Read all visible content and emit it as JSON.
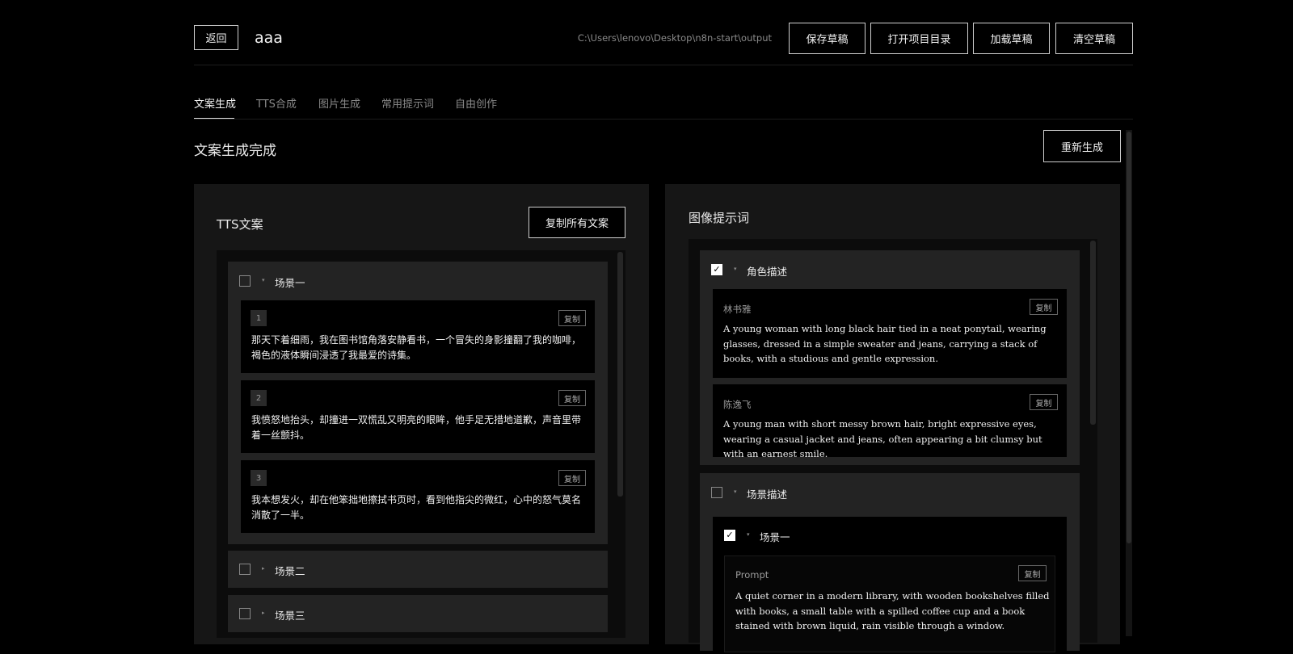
{
  "header": {
    "back_label": "返回",
    "project_name": "aaa",
    "path": "C:\\Users\\lenovo\\Desktop\\n8n-start\\output",
    "save_draft": "保存草稿",
    "open_dir": "打开项目目录",
    "load_draft": "加载草稿",
    "clear_draft": "清空草稿"
  },
  "tabs": [
    "文案生成",
    "TTS合成",
    "图片生成",
    "常用提示词",
    "自由创作"
  ],
  "status": {
    "title": "文案生成完成",
    "regenerate": "重新生成"
  },
  "tts_panel": {
    "title": "TTS文案",
    "copy_all": "复制所有文案",
    "scenes": [
      {
        "name": "场景一",
        "checked": false,
        "expanded": true,
        "lines": [
          {
            "num": "1",
            "text": "那天下着细雨，我在图书馆角落安静看书，一个冒失的身影撞翻了我的咖啡，褐色的液体瞬间浸透了我最爱的诗集。"
          },
          {
            "num": "2",
            "text": "我愤怒地抬头，却撞进一双慌乱又明亮的眼眸，他手足无措地道歉，声音里带着一丝颤抖。"
          },
          {
            "num": "3",
            "text": "我本想发火，却在他笨拙地擦拭书页时，看到他指尖的微红，心中的怒气莫名消散了一半。"
          }
        ]
      },
      {
        "name": "场景二",
        "checked": false,
        "expanded": false
      },
      {
        "name": "场景三",
        "checked": false,
        "expanded": false
      }
    ],
    "copy_label": "复制"
  },
  "image_panel": {
    "title": "图像提示词",
    "copy_label": "复制",
    "character_section": {
      "name": "角色描述",
      "checked": true,
      "characters": [
        {
          "name": "林书雅",
          "text": "A young woman with long black hair tied in a neat ponytail, wearing glasses, dressed in a simple sweater and jeans, carrying a stack of books, with a studious and gentle expression."
        },
        {
          "name": "陈逸飞",
          "text": "A young man with short messy brown hair, bright expressive eyes, wearing a casual jacket and jeans, often appearing a bit clumsy but with an earnest smile."
        }
      ]
    },
    "scene_section": {
      "name": "场景描述",
      "checked": false,
      "scene": {
        "name": "场景一",
        "checked": true,
        "prompt_label": "Prompt",
        "prompt_text": "A quiet corner in a modern library, with wooden bookshelves filled with books, a small table with a spilled coffee cup and a book stained with brown liquid, rain visible through a window."
      }
    }
  }
}
